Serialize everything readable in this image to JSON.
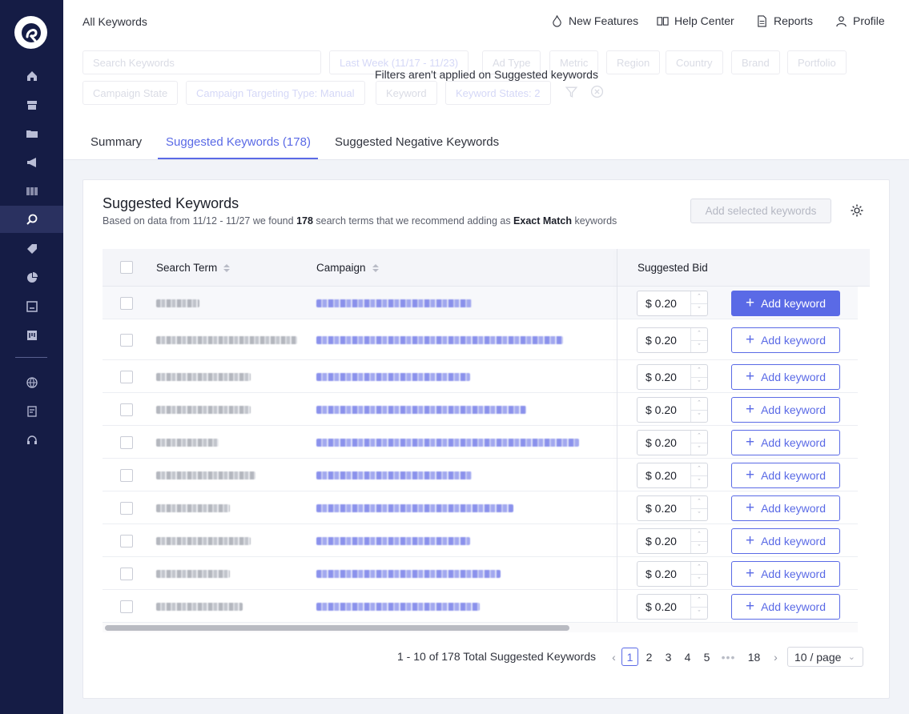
{
  "header": {
    "breadcrumb": "All Keywords",
    "links": [
      {
        "label": "New Features",
        "icon": "flame-icon"
      },
      {
        "label": "Help Center",
        "icon": "book-icon"
      },
      {
        "label": "Reports",
        "icon": "document-icon"
      },
      {
        "label": "Profile",
        "icon": "user-icon"
      }
    ]
  },
  "sidebar": {
    "items": [
      {
        "name": "home-icon"
      },
      {
        "name": "store-icon"
      },
      {
        "name": "folder-icon"
      },
      {
        "name": "megaphone-icon"
      },
      {
        "name": "barcode-icon"
      },
      {
        "name": "search-icon",
        "active": true
      },
      {
        "name": "tag-icon"
      },
      {
        "name": "pie-chart-icon"
      },
      {
        "name": "dashboard-icon"
      },
      {
        "name": "board-icon"
      },
      {
        "name": "globe-icon"
      },
      {
        "name": "report-icon"
      },
      {
        "name": "headset-icon"
      }
    ]
  },
  "filters": {
    "search_placeholder": "Search Keywords",
    "date": "Last Week (11/17 - 11/23)",
    "ad_type": "Ad Type",
    "metric": "Metric",
    "region": "Region",
    "country": "Country",
    "brand": "Brand",
    "portfolio": "Portfolio",
    "campaign_state": "Campaign State",
    "targeting": "Campaign Targeting Type: Manual",
    "keyword": "Keyword",
    "keyword_states": "Keyword States: 2",
    "note": "Filters aren't applied on Suggested keywords"
  },
  "tabs": [
    {
      "label": "Summary"
    },
    {
      "label": "Suggested Keywords (178)",
      "active": true
    },
    {
      "label": "Suggested Negative Keywords"
    }
  ],
  "card": {
    "title": "Suggested Keywords",
    "subtitle_pre": "Based on data from 11/12 - 11/27 we found ",
    "subtitle_count": "178",
    "subtitle_mid": " search terms that we recommend adding as ",
    "subtitle_match": "Exact Match",
    "subtitle_post": " keywords",
    "add_selected": "Add selected keywords"
  },
  "table": {
    "headers": {
      "search_term": "Search Term",
      "campaign": "Campaign",
      "suggested_bid": "Suggested Bid"
    },
    "rows": [
      {
        "bid": "$ 0.20",
        "action": "Add keyword"
      },
      {
        "bid": "$ 0.20",
        "action": "Add keyword"
      },
      {
        "bid": "$ 0.20",
        "action": "Add keyword"
      },
      {
        "bid": "$ 0.20",
        "action": "Add keyword"
      },
      {
        "bid": "$ 0.20",
        "action": "Add keyword"
      },
      {
        "bid": "$ 0.20",
        "action": "Add keyword"
      },
      {
        "bid": "$ 0.20",
        "action": "Add keyword"
      },
      {
        "bid": "$ 0.20",
        "action": "Add keyword"
      },
      {
        "bid": "$ 0.20",
        "action": "Add keyword"
      },
      {
        "bid": "$ 0.20",
        "action": "Add keyword"
      }
    ]
  },
  "pagination": {
    "summary": "1 - 10 of 178 Total Suggested Keywords",
    "pages": [
      "1",
      "2",
      "3",
      "4",
      "5",
      "18"
    ],
    "current": "1",
    "more": "•••",
    "page_size": "10 / page"
  },
  "colors": {
    "accent": "#5a6ae6",
    "sidebar": "#151c45"
  }
}
